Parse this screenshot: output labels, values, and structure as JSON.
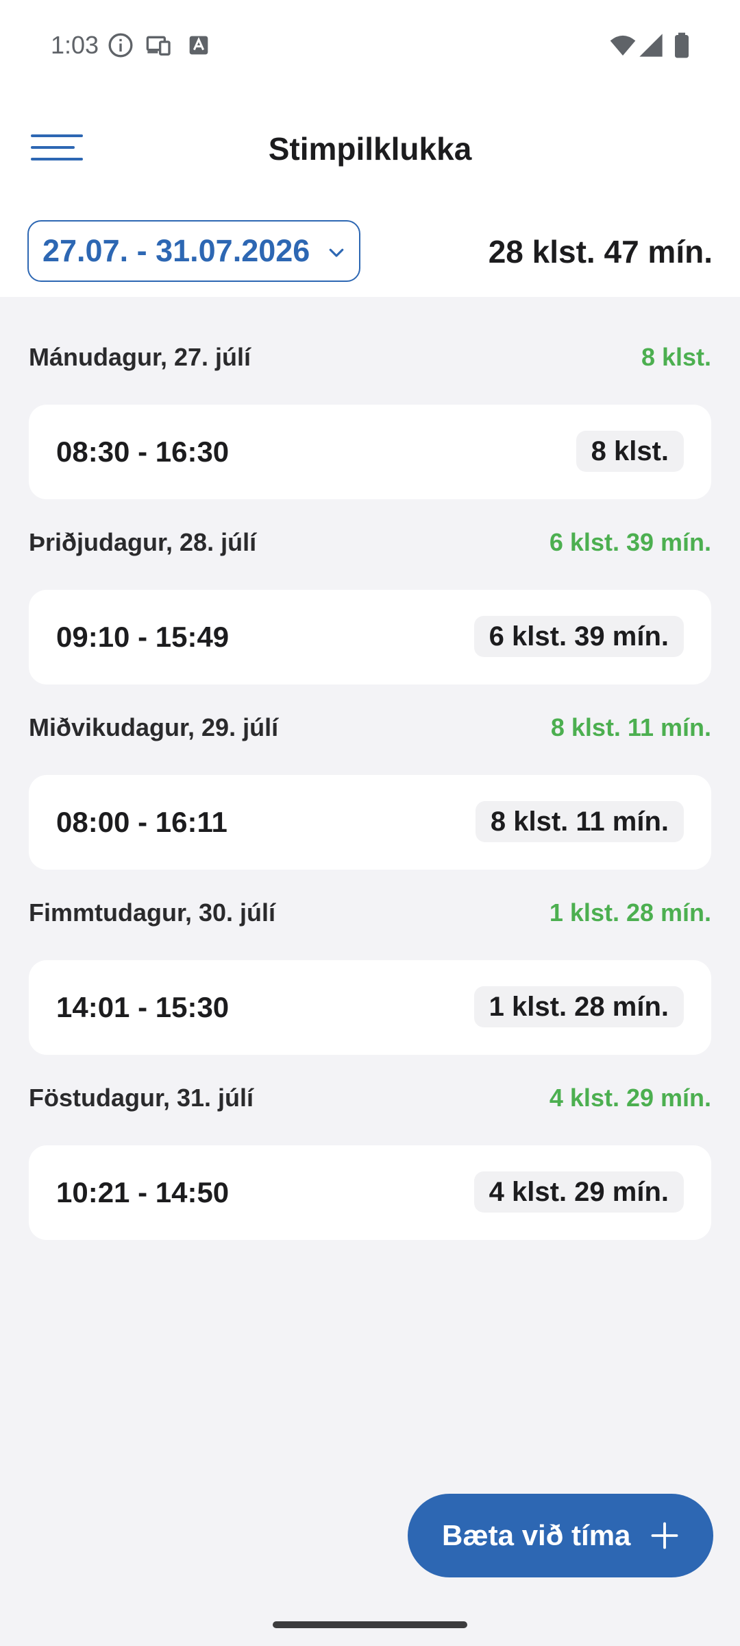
{
  "status_bar": {
    "time": "1:03",
    "icons": [
      "info-icon",
      "cast-icon",
      "keyboard-icon",
      "wifi-icon",
      "signal-icon",
      "battery-icon"
    ]
  },
  "app_bar": {
    "title": "Stimpilklukka",
    "menu_icon": "hamburger-menu-icon"
  },
  "summary": {
    "date_range": "27.07. - 31.07.2026",
    "total": "28 klst. 47 mín."
  },
  "days": [
    {
      "label": "Mánudagur, 27. júlí",
      "total": "8 klst.",
      "entry": {
        "range": "08:30 - 16:30",
        "duration": "8 klst."
      }
    },
    {
      "label": "Þriðjudagur, 28. júlí",
      "total": "6 klst. 39 mín.",
      "entry": {
        "range": "09:10 - 15:49",
        "duration": "6 klst. 39 mín."
      }
    },
    {
      "label": "Miðvikudagur, 29. júlí",
      "total": "8 klst. 11 mín.",
      "entry": {
        "range": "08:00 - 16:11",
        "duration": "8 klst. 11 mín."
      }
    },
    {
      "label": "Fimmtudagur, 30. júlí",
      "total": "1 klst. 28 mín.",
      "entry": {
        "range": "14:01 - 15:30",
        "duration": "1 klst. 28 mín."
      }
    },
    {
      "label": "Föstudagur, 31. júlí",
      "total": "4 klst. 29 mín.",
      "entry": {
        "range": "10:21 - 14:50",
        "duration": "4 klst. 29 mín."
      }
    }
  ],
  "fab": {
    "label": "Bæta við tíma",
    "icon": "plus-icon"
  },
  "colors": {
    "primary": "#2d67b3",
    "positive": "#4caf50",
    "background": "#f3f3f6",
    "card": "#ffffff"
  }
}
